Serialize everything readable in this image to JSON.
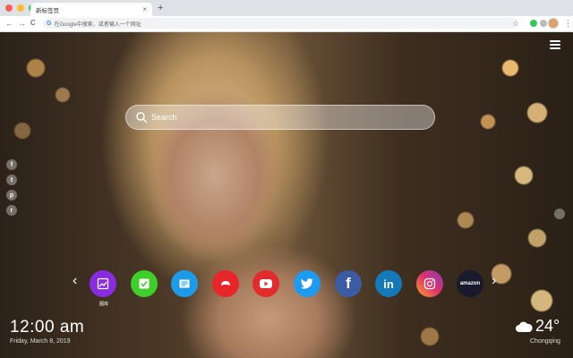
{
  "browser": {
    "tab_title": "新标签页",
    "tab_close": "×",
    "new_tab": "+",
    "omnibox_placeholder": "在Google中搜索，或者输入一个网址",
    "omnibox_g": "G",
    "nav_back": "←",
    "nav_forward": "→",
    "nav_reload": "C",
    "bookmark_star": "☆",
    "menu": "⋮"
  },
  "search": {
    "placeholder": "Search"
  },
  "side_icons": [
    {
      "icon": "facebook-icon",
      "glyph": "f"
    },
    {
      "icon": "twitter-icon",
      "glyph": "t"
    },
    {
      "icon": "pinterest-icon",
      "glyph": "p"
    },
    {
      "icon": "reddit-icon",
      "glyph": "r"
    }
  ],
  "shortcuts": [
    {
      "name": "wallpaper",
      "label": "图库",
      "color": "#8a2be2",
      "glyph": "▨"
    },
    {
      "name": "todo",
      "label": "",
      "color": "#3ecf2a",
      "glyph": "✓"
    },
    {
      "name": "news",
      "label": "",
      "color": "#1e9be8",
      "glyph": "▤"
    },
    {
      "name": "games",
      "label": "",
      "color": "#e8262a",
      "glyph": "◐"
    },
    {
      "name": "youtube",
      "label": "",
      "color": "#e22b2b",
      "glyph": "▶"
    },
    {
      "name": "twitter",
      "label": "",
      "color": "#1d9bf0",
      "glyph": "t"
    },
    {
      "name": "facebook",
      "label": "",
      "color": "#3b5ba3",
      "glyph": "f"
    },
    {
      "name": "linkedin",
      "label": "",
      "color": "#1479b8",
      "glyph": "in"
    },
    {
      "name": "instagram",
      "label": "",
      "color": "#d83a8c",
      "glyph": "◎"
    },
    {
      "name": "amazon",
      "label": "",
      "color": "#1a1a2e",
      "glyph": "amazon"
    }
  ],
  "arrows": {
    "prev": "‹",
    "next": "›"
  },
  "clock": {
    "time": "12:00 am",
    "date": "Friday, March 8, 2019"
  },
  "weather": {
    "temp": "24°",
    "city": "Chongqing"
  }
}
